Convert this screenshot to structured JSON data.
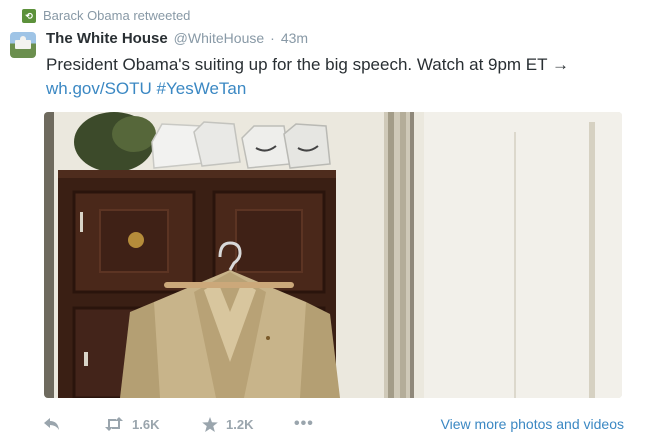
{
  "retweet": {
    "badge": "⟲",
    "label": "Barack Obama retweeted"
  },
  "author": {
    "name": "The White House",
    "handle": "@WhiteHouse",
    "separator": "·",
    "time": "43m"
  },
  "tweet": {
    "text": "President Obama's suiting up for the big speech. Watch at 9pm ET →",
    "link": "wh.gov/SOTU",
    "hashtag": "#YesWeTan"
  },
  "photo": {
    "alt": "Tan suit on hanger in front of cabinet with sneakers"
  },
  "actions": {
    "retweet_count": "1.6K",
    "favorite_count": "1.2K",
    "more": "•••",
    "view_more": "View more photos and videos"
  },
  "colors": {
    "link": "#3b88c3",
    "muted": "#8899a6",
    "retweet_badge": "#5c913b"
  }
}
